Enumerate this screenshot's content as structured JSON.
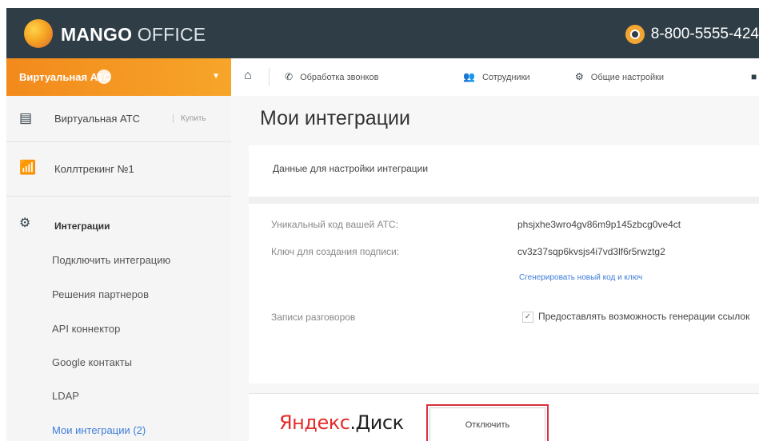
{
  "header": {
    "brand_bold": "MANGO",
    "brand_light": " OFFICE",
    "phone": "8-800-5555-424"
  },
  "sidebar": {
    "atc_dropdown_label": "Виртуальная АТС",
    "items": [
      {
        "label": "Виртуальная АТС",
        "action": "Купить",
        "icon": "pbx-icon"
      },
      {
        "label": "Коллтрекинг №1",
        "icon": "calltracking-icon"
      },
      {
        "label": "Интеграции",
        "icon": "integrations-icon"
      }
    ],
    "subitems": [
      {
        "label": "Подключить интеграцию"
      },
      {
        "label": "Решения партнеров"
      },
      {
        "label": "API коннектор"
      },
      {
        "label": "Google контакты"
      },
      {
        "label": "LDAP"
      },
      {
        "label": "Мои интеграции (2)",
        "active": true
      }
    ]
  },
  "topnav": {
    "items": [
      {
        "label": "Обработка звонков",
        "icon": "phone-handset-icon"
      },
      {
        "label": "Сотрудники",
        "icon": "people-icon"
      },
      {
        "label": "Общие настройки",
        "icon": "gear-icon"
      }
    ]
  },
  "main": {
    "title": "Мои интеграции",
    "settings_card": {
      "heading": "Данные для настройки интеграции",
      "unique_code_label": "Уникальный код вашей АТС:",
      "unique_code_value": "phsjxhe3wro4gv86m9p145zbcg0ve4ct",
      "signature_key_label": "Ключ для создания подписи:",
      "signature_key_value": "cv3z37sqp6kvsjs4i7vd3lf6r5rwztg2",
      "generate_link": "Сгенерировать новый код и ключ",
      "recordings_label": "Записи разговоров",
      "recordings_option": "Предоставлять возможность генерации ссылок",
      "recordings_checked": true
    },
    "yandex_card": {
      "logo_part1": "Яндекс",
      "logo_part2": ".Диск",
      "disable_button": "Отключить"
    }
  },
  "colors": {
    "header_bg": "#2f3e46",
    "accent_orange": "#f28a1c",
    "link_blue": "#3d7dd8",
    "highlight_red": "#d9303b",
    "yandex_red": "#e62b2b"
  }
}
